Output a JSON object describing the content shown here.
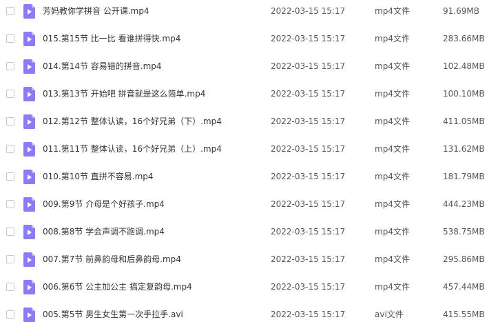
{
  "files": [
    {
      "name": "芳妈教你学拼音  公开课.mp4",
      "modified": "2022-03-15 15:17",
      "type": "mp4文件",
      "size": "91.69MB"
    },
    {
      "name": "015.第15节 比一比 看谁拼得快.mp4",
      "modified": "2022-03-15 15:17",
      "type": "mp4文件",
      "size": "283.66MB"
    },
    {
      "name": "014.第14节 容易错的拼音.mp4",
      "modified": "2022-03-15 15:17",
      "type": "mp4文件",
      "size": "102.48MB"
    },
    {
      "name": "013.第13节 开始吧 拼音就是这么简单.mp4",
      "modified": "2022-03-15 15:17",
      "type": "mp4文件",
      "size": "100.10MB"
    },
    {
      "name": "012.第12节 整体认读，16个好兄弟（下）.mp4",
      "modified": "2022-03-15 15:17",
      "type": "mp4文件",
      "size": "411.05MB"
    },
    {
      "name": "011.第11节 整体认读，16个好兄弟（上）.mp4",
      "modified": "2022-03-15 15:17",
      "type": "mp4文件",
      "size": "131.62MB"
    },
    {
      "name": "010.第10节 直拼不容易.mp4",
      "modified": "2022-03-15 15:17",
      "type": "mp4文件",
      "size": "181.79MB"
    },
    {
      "name": "009.第9节 介母是个好孩子.mp4",
      "modified": "2022-03-15 15:17",
      "type": "mp4文件",
      "size": "444.23MB"
    },
    {
      "name": "008.第8节 学会声调不跑调.mp4",
      "modified": "2022-03-15 15:17",
      "type": "mp4文件",
      "size": "538.75MB"
    },
    {
      "name": "007.第7节 前鼻韵母和后鼻韵母.mp4",
      "modified": "2022-03-15 15:17",
      "type": "mp4文件",
      "size": "295.86MB"
    },
    {
      "name": "006.第6节 公主加公主 搞定复韵母.mp4",
      "modified": "2022-03-15 15:17",
      "type": "mp4文件",
      "size": "457.44MB"
    },
    {
      "name": "005.第5节 男生女生第一次手拉手.avi",
      "modified": "2022-03-15 15:17",
      "type": "avi文件",
      "size": "415.55MB"
    }
  ],
  "icon": {
    "name": "video-file-icon",
    "color": "#8B7CF6",
    "fold_color": "#C4BAFB"
  }
}
